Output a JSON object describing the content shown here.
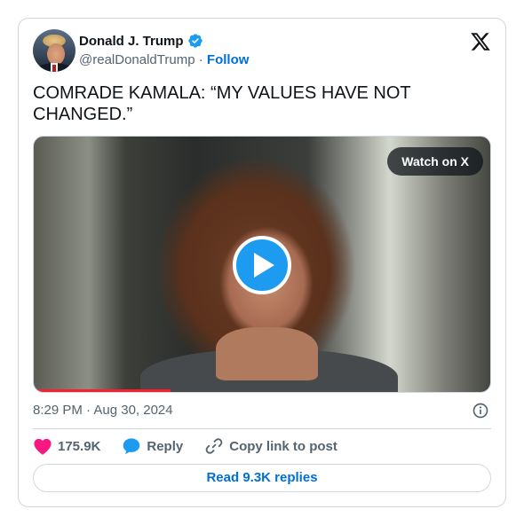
{
  "author": {
    "name": "Donald J. Trump",
    "handle": "@realDonaldTrump",
    "separator": "·",
    "follow_label": "Follow",
    "verified": true
  },
  "brand_icon": "x-logo-icon",
  "tweet": {
    "text": "COMRADE KAMALA: “MY VALUES HAVE NOT CHANGED.”"
  },
  "media": {
    "watch_label": "Watch on X",
    "play_icon": "play-icon",
    "progress": 0.3
  },
  "meta": {
    "timestamp": "8:29 PM · Aug 30, 2024",
    "info_icon": "info-icon"
  },
  "actions": {
    "likes": "175.9K",
    "reply_label": "Reply",
    "copy_label": "Copy link to post"
  },
  "read_replies_label": "Read 9.3K replies",
  "colors": {
    "accent": "#1d9bf0",
    "link": "#006fd6",
    "like": "#f91880",
    "text": "#0f1419",
    "muted": "#536471",
    "border": "#cfd9de"
  }
}
